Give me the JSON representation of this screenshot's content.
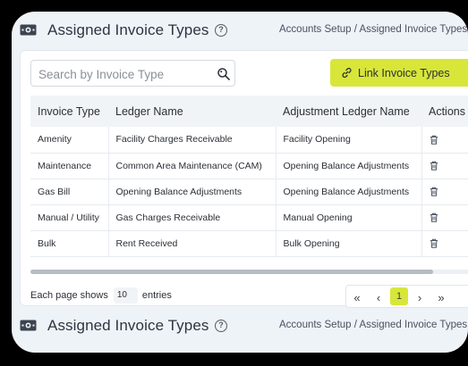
{
  "header": {
    "title": "Assigned Invoice Types",
    "help_symbol": "?",
    "breadcrumb": "Accounts Setup / Assigned Invoice Types"
  },
  "search": {
    "placeholder": "Search by Invoice Type",
    "value": ""
  },
  "link_button": {
    "label": "Link Invoice Types"
  },
  "table": {
    "columns": [
      "Invoice Type",
      "Ledger Name",
      "Adjustment Ledger Name",
      "Actions"
    ],
    "rows": [
      {
        "invoice_type": "Amenity",
        "ledger_name": "Facility Charges Receivable",
        "adjustment_ledger": "Facility Opening"
      },
      {
        "invoice_type": "Maintenance",
        "ledger_name": "Common Area Maintenance (CAM)",
        "adjustment_ledger": "Opening Balance Adjustments"
      },
      {
        "invoice_type": "Gas Bill",
        "ledger_name": "Opening Balance Adjustments",
        "adjustment_ledger": "Opening Balance Adjustments"
      },
      {
        "invoice_type": "Manual / Utility",
        "ledger_name": "Gas Charges Receivable",
        "adjustment_ledger": "Manual Opening"
      },
      {
        "invoice_type": "Bulk",
        "ledger_name": "Rent Received",
        "adjustment_ledger": "Bulk Opening"
      }
    ]
  },
  "pagination": {
    "page_size_prefix": "Each page shows",
    "page_size": "10",
    "page_size_suffix": "entries",
    "first": "«",
    "prev": "‹",
    "current_page": "1",
    "next": "›",
    "last": "»"
  },
  "colors": {
    "accent": "#d8e63a",
    "background": "#eef3f8",
    "table_header": "#f1f4f7"
  },
  "icons": [
    "cash-icon",
    "help-icon",
    "search-icon",
    "link-icon",
    "trash-icon"
  ]
}
